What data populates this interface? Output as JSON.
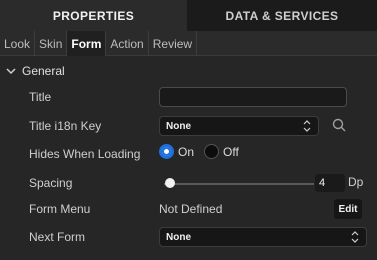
{
  "tabs": {
    "properties": "PROPERTIES",
    "data_services": "DATA & SERVICES"
  },
  "sub_tabs": [
    "Look",
    "Skin",
    "Form",
    "Action",
    "Review"
  ],
  "active_sub_tab": "Form",
  "section": {
    "title": "General",
    "expanded": true
  },
  "fields": {
    "title": {
      "label": "Title",
      "value": ""
    },
    "title_i18n": {
      "label": "Title i18n Key",
      "value": "None"
    },
    "hides_when_loading": {
      "label": "Hides When Loading",
      "on_label": "On",
      "off_label": "Off",
      "selected": "On"
    },
    "spacing": {
      "label": "Spacing",
      "value": "4",
      "unit": "Dp"
    },
    "form_menu": {
      "label": "Form Menu",
      "value": "Not Defined",
      "button": "Edit"
    },
    "next_form": {
      "label": "Next Form",
      "value": "None"
    }
  },
  "icons": [
    "chevron-down-icon",
    "search-icon",
    "updown-caret-icon"
  ],
  "colors": {
    "accent": "#1f6fdd",
    "background": "#262626"
  }
}
